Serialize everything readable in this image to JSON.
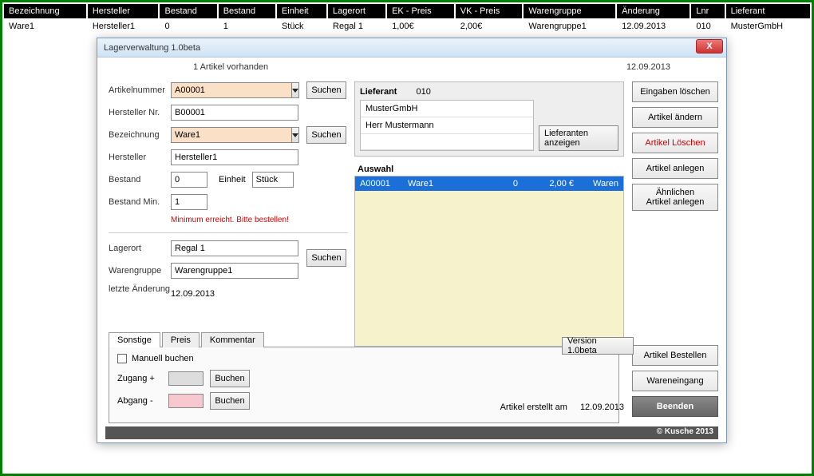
{
  "bg": {
    "headers": [
      "Bezeichnung",
      "Hersteller",
      "Bestand",
      "Bestand",
      "Einheit",
      "Lagerort",
      "EK - Preis",
      "VK - Preis",
      "Warengruppe",
      "Änderung",
      "Lnr",
      "Lieferant"
    ],
    "row": [
      "Ware1",
      "Hersteller1",
      "0",
      "1",
      "Stück",
      "Regal 1",
      "1,00€",
      "2,00€",
      "Warengruppe1",
      "12.09.2013",
      "010",
      "MusterGmbH"
    ]
  },
  "dialog": {
    "title": "Lagerverwaltung 1.0beta",
    "close_x": "X",
    "count_text": "1 Artikel vorhanden",
    "date": "12.09.2013"
  },
  "form": {
    "artikelnummer_label": "Artikelnummer",
    "artikelnummer_value": "A00001",
    "herstellernr_label": "Hersteller Nr.",
    "herstellernr_value": "B00001",
    "bezeichnung_label": "Bezeichnung",
    "bezeichnung_value": "Ware1",
    "hersteller_label": "Hersteller",
    "hersteller_value": "Hersteller1",
    "bestand_label": "Bestand",
    "bestand_value": "0",
    "einheit_label": "Einheit",
    "einheit_value": "Stück",
    "bestandmin_label": "Bestand Min.",
    "bestandmin_value": "1",
    "warn_text": "Minimum erreicht. Bitte bestellen!",
    "lagerort_label": "Lagerort",
    "lagerort_value": "Regal 1",
    "warengruppe_label": "Warengruppe",
    "warengruppe_value": "Warengruppe1",
    "letzte_label": "letzte Änderung",
    "letzte_value": "12.09.2013",
    "suchen": "Suchen"
  },
  "supplier": {
    "title": "Lieferant",
    "code": "010",
    "name1": "MusterGmbH",
    "name2": "Herr Mustermann",
    "show_btn": "Lieferanten anzeigen"
  },
  "selection": {
    "title": "Auswahl",
    "row": {
      "c1": "A00001",
      "c2": "Ware1",
      "c3": "0",
      "c4": "2,00 €",
      "c5": "Waren"
    }
  },
  "buttons": {
    "eingaben_loeschen": "Eingaben löschen",
    "artikel_aendern": "Artikel ändern",
    "artikel_loeschen": "Artikel Löschen",
    "artikel_anlegen": "Artikel anlegen",
    "aehnlichen": "Ähnlichen\nArtikel anlegen",
    "artikel_bestellen": "Artikel Bestellen",
    "wareneingang": "Wareneingang",
    "beenden": "Beenden"
  },
  "tabs": {
    "sonstige": "Sonstige",
    "preis": "Preis",
    "kommentar": "Kommentar"
  },
  "booking": {
    "manuell": "Manuell buchen",
    "zugang": "Zugang +",
    "abgang": "Abgang -",
    "buchen": "Buchen"
  },
  "version_btn": "Version 1.0beta",
  "erstellt_label": "Artikel erstellt am",
  "erstellt_date": "12.09.2013",
  "copyright": "© Kusche 2013"
}
